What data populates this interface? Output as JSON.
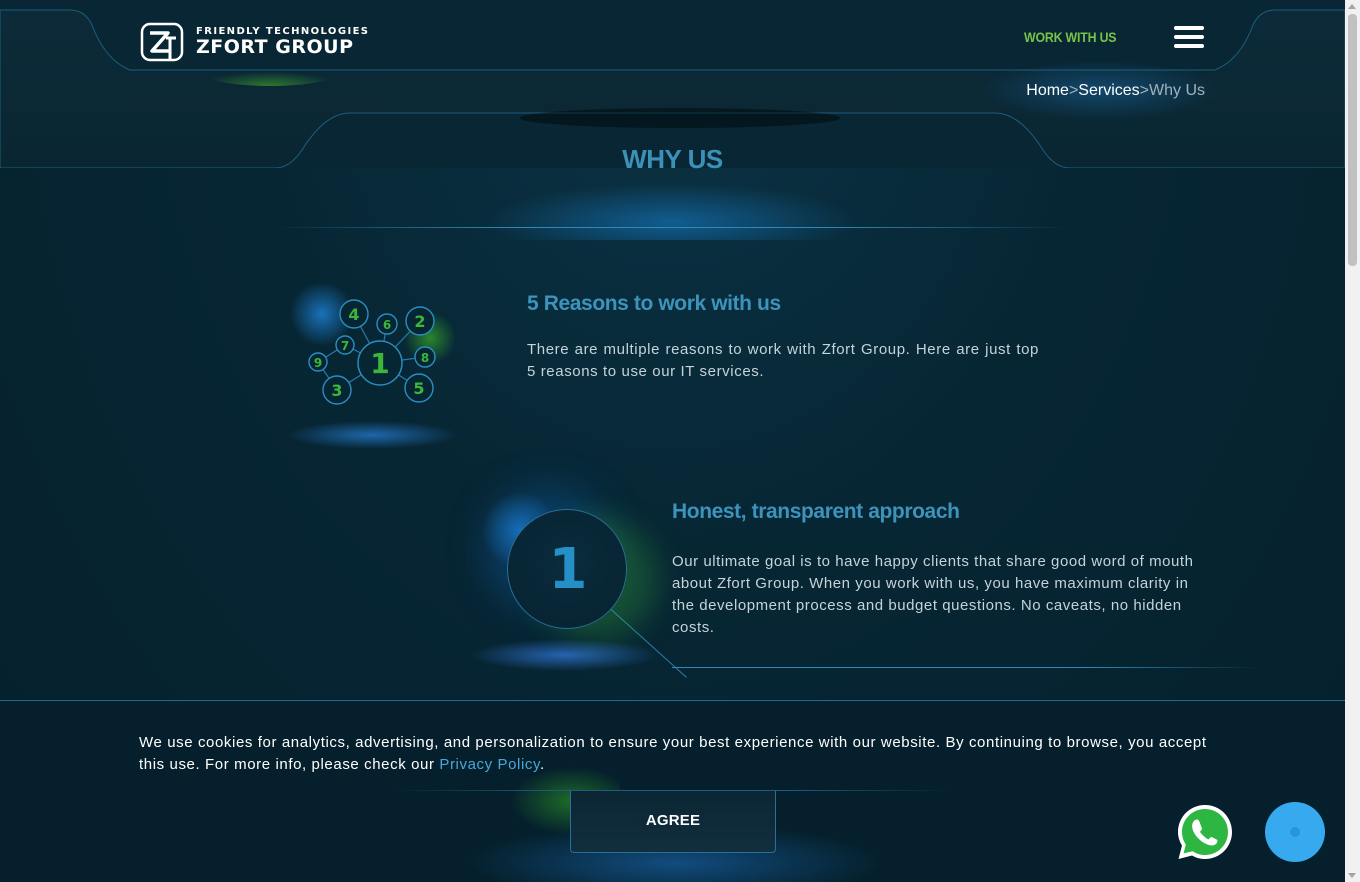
{
  "header": {
    "logo_tagline": "FRIENDLY TECHNOLOGIES",
    "logo_name": "ZFORT GROUP",
    "work_with_us": "WORK WITH US",
    "menu_icon": "hamburger-menu-icon"
  },
  "breadcrumb": {
    "home": "Home",
    "services": "Services",
    "current": "Why Us",
    "separator": ">"
  },
  "page": {
    "title": "WHY US"
  },
  "intro": {
    "title": "5 Reasons to work with us",
    "text": "There are multiple reasons to work with Zfort Group. Here are just top 5 reasons to use our IT services.",
    "graphic_numbers": [
      "1",
      "2",
      "3",
      "4",
      "5",
      "6",
      "7",
      "8",
      "9"
    ]
  },
  "reasons": [
    {
      "number": "1",
      "title": "Honest, transparent approach",
      "text": "Our ultimate goal is to have happy clients that share good word of mouth about Zfort Group. When you work with us, you have maximum clarity in the development process and budget questions. No caveats, no hidden costs."
    }
  ],
  "cookie": {
    "text": "We use cookies for analytics, advertising, and personalization to ensure your best experience with our website. By continuing to browse, you accept this use. For more info, please check our",
    "link": "Privacy Policy",
    "period": ".",
    "agree": "AGREE"
  },
  "floating": {
    "whatsapp_icon": "whatsapp-icon",
    "chat_icon": "chat-icon"
  },
  "colors": {
    "background": "#062331",
    "accent_blue": "#3d93bb",
    "accent_green": "#79c24a",
    "link_blue": "#4aa6d8",
    "chat_blue": "#36a9ef",
    "whatsapp_green": "#2db742"
  }
}
